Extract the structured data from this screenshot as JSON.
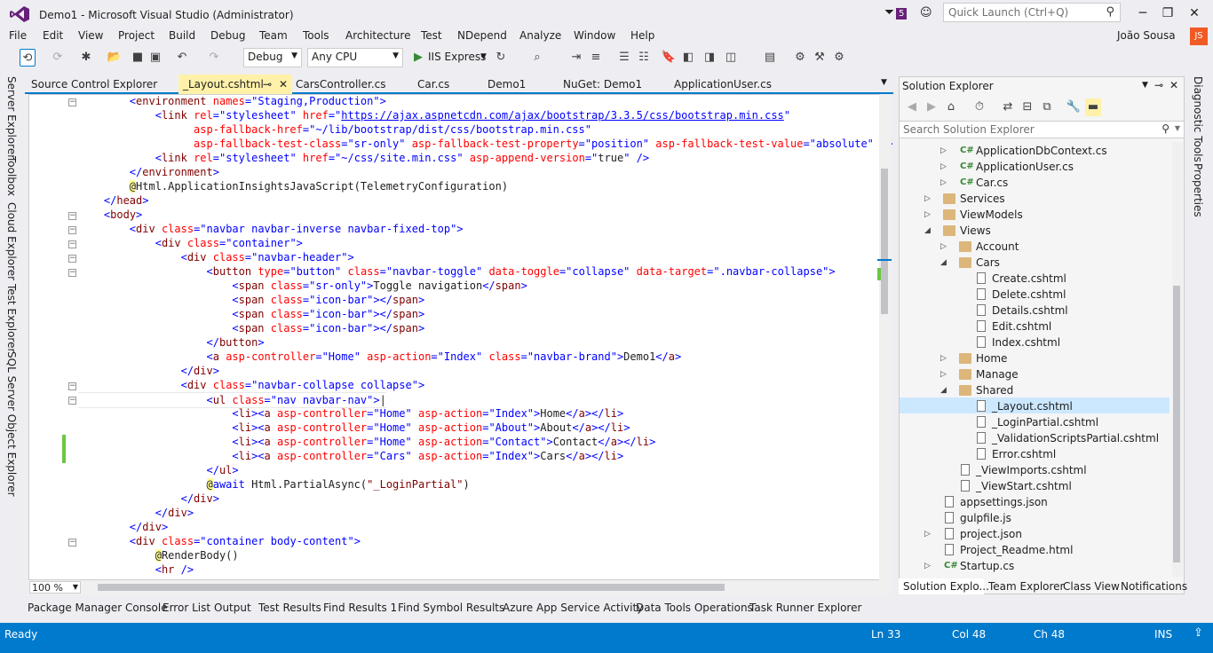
{
  "window": {
    "title": "Demo1 - Microsoft Visual Studio (Administrator)",
    "notifications": "5",
    "quick_launch_placeholder": "Quick Launch (Ctrl+Q)"
  },
  "menu": [
    "File",
    "Edit",
    "View",
    "Project",
    "Build",
    "Debug",
    "Team",
    "Tools",
    "Architecture",
    "Test",
    "NDepend",
    "Analyze",
    "Window",
    "Help"
  ],
  "user": {
    "name": "João Sousa",
    "initials": "JS"
  },
  "toolbar": {
    "config": "Debug",
    "platform": "Any CPU",
    "run_target": "IIS Express"
  },
  "left_tools": [
    "Server Explorer",
    "Toolbox",
    "Cloud Explorer",
    "Test Explorer",
    "SQL Server Object Explorer"
  ],
  "right_tools": [
    "Diagnostic Tools",
    "Properties"
  ],
  "doc_tabs": [
    "Source Control Explorer",
    "_Layout.cshtml",
    "CarsController.cs",
    "Car.cs",
    "Demo1",
    "NuGet: Demo1",
    "ApplicationUser.cs"
  ],
  "editor": {
    "zoom": "100 %"
  },
  "solution_explorer": {
    "title": "Solution Explorer",
    "search_placeholder": "Search Solution Explorer",
    "items": [
      "ApplicationDbContext.cs",
      "ApplicationUser.cs",
      "Car.cs",
      "Services",
      "ViewModels",
      "Views",
      "Account",
      "Cars",
      "Create.cshtml",
      "Delete.cshtml",
      "Details.cshtml",
      "Edit.cshtml",
      "Index.cshtml",
      "Home",
      "Manage",
      "Shared",
      "_Layout.cshtml",
      "_LoginPartial.cshtml",
      "_ValidationScriptsPartial.cshtml",
      "Error.cshtml",
      "_ViewImports.cshtml",
      "_ViewStart.cshtml",
      "appsettings.json",
      "gulpfile.js",
      "project.json",
      "Project_Readme.html",
      "Startup.cs"
    ],
    "bottom_tabs": [
      "Solution Explo...",
      "Team Explorer",
      "Class View",
      "Notifications"
    ]
  },
  "bottom_tabs": [
    "Package Manager Console",
    "Error List",
    "Output",
    "Test Results",
    "Find Results 1",
    "Find Symbol Results",
    "Azure App Service Activity",
    "Data Tools Operations",
    "Task Runner Explorer"
  ],
  "status": {
    "state": "Ready",
    "ln": "Ln 33",
    "col": "Col 48",
    "ch": "Ch 48",
    "mode": "INS"
  },
  "colors": {
    "accent": "#007acc",
    "vs_purple": "#68217a"
  }
}
